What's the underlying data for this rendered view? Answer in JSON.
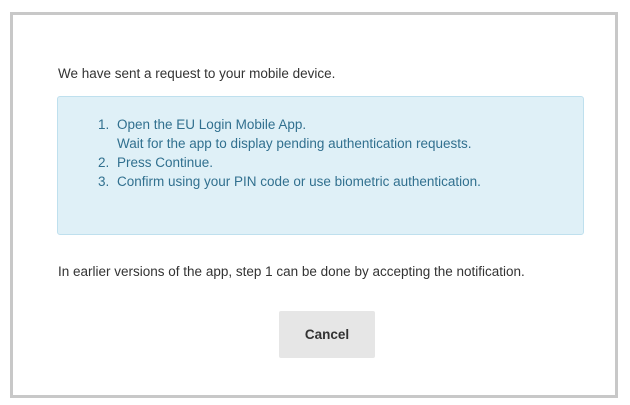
{
  "dialog": {
    "intro_text": "We have sent a request to your mobile device.",
    "steps": [
      {
        "number": "1.",
        "text": "Open the EU Login Mobile App.",
        "subtext": "Wait for the app to display pending authentication requests."
      },
      {
        "number": "2.",
        "text": "Press Continue."
      },
      {
        "number": "3.",
        "text": "Confirm using your PIN code or use biometric authentication."
      }
    ],
    "note_text": "In earlier versions of the app, step 1 can be done by accepting the notification.",
    "cancel_label": "Cancel"
  },
  "colors": {
    "info_box_background": "#dff0f7",
    "info_box_text": "#31708f",
    "button_background": "#e6e6e6",
    "frame_border": "#c8c8c8"
  }
}
